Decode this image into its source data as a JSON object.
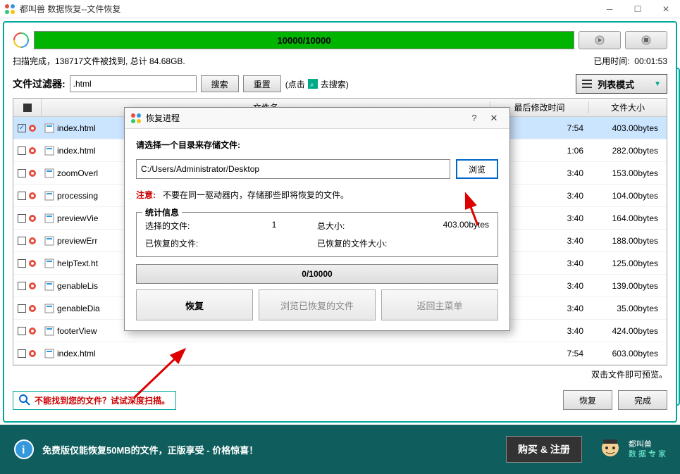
{
  "window": {
    "title": "都叫兽 数据恢复--文件恢复"
  },
  "progress": {
    "text": "10000/10000"
  },
  "scan": {
    "status": "扫描完成，138717文件被找到, 总计 84.68GB.",
    "elapsed_label": "已用时间:",
    "elapsed_value": "00:01:53"
  },
  "filter": {
    "label": "文件过滤器:",
    "value": ".html",
    "search": "搜索",
    "reset": "重置",
    "hint_prefix": "(点击",
    "hint_suffix": "去搜索)",
    "mode": "列表模式"
  },
  "table": {
    "headers": {
      "name": "文件名",
      "date": "最后修改时间",
      "size": "文件大小"
    },
    "rows": [
      {
        "checked": true,
        "name": "index.html",
        "time": "7:54",
        "size": "403.00bytes"
      },
      {
        "checked": false,
        "name": "index.html",
        "time": "1:06",
        "size": "282.00bytes"
      },
      {
        "checked": false,
        "name": "zoomOverl",
        "time": "3:40",
        "size": "153.00bytes"
      },
      {
        "checked": false,
        "name": "processing",
        "time": "3:40",
        "size": "104.00bytes"
      },
      {
        "checked": false,
        "name": "previewVie",
        "time": "3:40",
        "size": "164.00bytes"
      },
      {
        "checked": false,
        "name": "previewErr",
        "time": "3:40",
        "size": "188.00bytes"
      },
      {
        "checked": false,
        "name": "helpText.ht",
        "time": "3:40",
        "size": "125.00bytes"
      },
      {
        "checked": false,
        "name": "genableLis",
        "time": "3:40",
        "size": "139.00bytes"
      },
      {
        "checked": false,
        "name": "genableDia",
        "time": "3:40",
        "size": "35.00bytes"
      },
      {
        "checked": false,
        "name": "footerView",
        "time": "3:40",
        "size": "424.00bytes"
      },
      {
        "checked": false,
        "name": "index.html",
        "time": "7:54",
        "size": "603.00bytes"
      }
    ],
    "hint": "双击文件即可预览。"
  },
  "deep_scan": "不能找到您的文件？试试深度扫描。",
  "buttons": {
    "recover": "恢复",
    "done": "完成"
  },
  "banner": {
    "text": "免费版仅能恢复50MB的文件，正版享受 - 价格惊喜！",
    "buy": "购买 & 注册",
    "brand": "都叫兽",
    "brand_sub": "数 据 专 家"
  },
  "modal": {
    "title": "恢复进程",
    "instruction": "请选择一个目录来存储文件:",
    "path": "C:/Users/Administrator/Desktop",
    "browse": "浏览",
    "warn_label": "注意:",
    "warn_text": "不要在同一驱动器内，存储那些即将恢复的文件。",
    "stats_title": "统计信息",
    "stats": {
      "selected_label": "选择的文件:",
      "selected_value": "1",
      "total_label": "总大小:",
      "total_value": "403.00bytes",
      "recovered_label": "已恢复的文件:",
      "recovered_value": "",
      "recovered_size_label": "已恢复的文件大小:",
      "recovered_size_value": ""
    },
    "progress": "0/10000",
    "btn_recover": "恢复",
    "btn_browse_recovered": "浏览已恢复的文件",
    "btn_back": "返回主菜单"
  }
}
